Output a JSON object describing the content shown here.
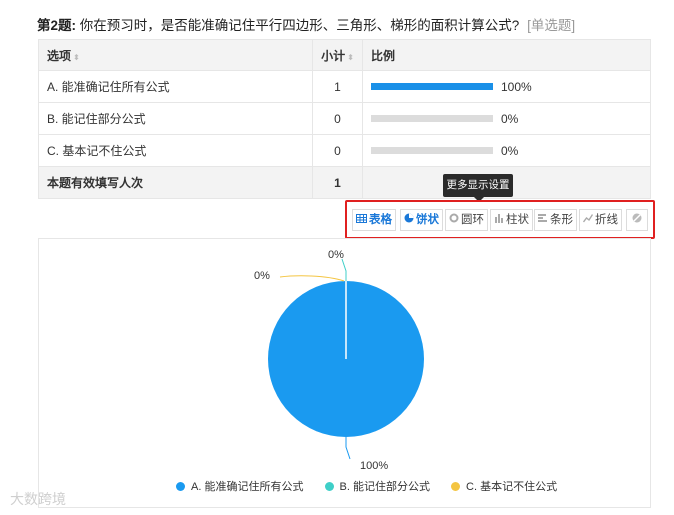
{
  "question": {
    "number": "第2题:",
    "text": "你在预习时，是否能准确记住平行四边形、三角形、梯形的面积计算公式?",
    "type_tag": "[单选题]"
  },
  "table": {
    "headers": {
      "option": "选项",
      "count": "小计",
      "ratio": "比例"
    },
    "rows": [
      {
        "option": "A. 能准确记住所有公式",
        "count": "1",
        "percent": "100%",
        "fraction": 1.0
      },
      {
        "option": "B. 能记住部分公式",
        "count": "0",
        "percent": "0%",
        "fraction": 0.0
      },
      {
        "option": "C. 基本记不住公式",
        "count": "0",
        "percent": "0%",
        "fraction": 0.0
      }
    ],
    "footer": {
      "label": "本题有效填写人次",
      "count": "1"
    }
  },
  "tooltip": "更多显示设置",
  "toolbar": {
    "table": "表格",
    "pie": "饼状",
    "ring": "圆环",
    "column": "柱状",
    "bar": "条形",
    "line": "折线"
  },
  "chart_data": {
    "type": "pie",
    "categories": [
      "A. 能准确记住所有公式",
      "B. 能记住部分公式",
      "C. 基本记不住公式"
    ],
    "values": [
      100,
      0,
      0
    ],
    "labels": [
      "100%",
      "0%",
      "0%"
    ],
    "colors": [
      "#1a9af0",
      "#3fcfc8",
      "#f4c542"
    ],
    "legend_position": "bottom"
  },
  "watermark": "大数跨境"
}
